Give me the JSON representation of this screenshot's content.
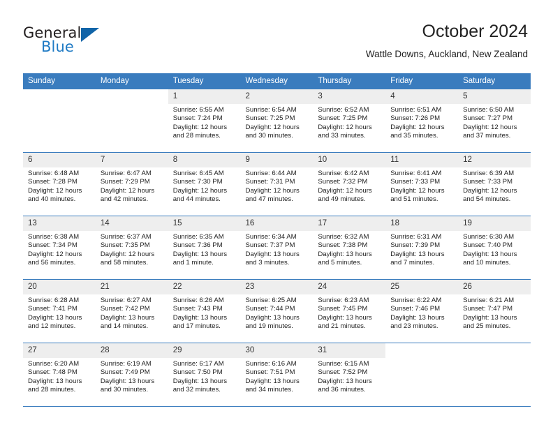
{
  "brand": {
    "name_part1": "General",
    "name_part2": "Blue",
    "accent_color": "#1064a8",
    "text_color": "#231f20"
  },
  "header": {
    "title": "October 2024",
    "subtitle": "Wattle Downs, Auckland, New Zealand"
  },
  "theme": {
    "header_row_bg": "#3a7cbe",
    "daynum_bg": "#eeeeee",
    "grid_line": "#3a7cbe"
  },
  "weekday_headers": [
    "Sunday",
    "Monday",
    "Tuesday",
    "Wednesday",
    "Thursday",
    "Friday",
    "Saturday"
  ],
  "weeks": [
    [
      {
        "day": "",
        "sunrise": "",
        "sunset": "",
        "daylight_line1": "",
        "daylight_line2": ""
      },
      {
        "day": "",
        "sunrise": "",
        "sunset": "",
        "daylight_line1": "",
        "daylight_line2": ""
      },
      {
        "day": "1",
        "sunrise": "Sunrise: 6:55 AM",
        "sunset": "Sunset: 7:24 PM",
        "daylight_line1": "Daylight: 12 hours",
        "daylight_line2": "and 28 minutes."
      },
      {
        "day": "2",
        "sunrise": "Sunrise: 6:54 AM",
        "sunset": "Sunset: 7:25 PM",
        "daylight_line1": "Daylight: 12 hours",
        "daylight_line2": "and 30 minutes."
      },
      {
        "day": "3",
        "sunrise": "Sunrise: 6:52 AM",
        "sunset": "Sunset: 7:25 PM",
        "daylight_line1": "Daylight: 12 hours",
        "daylight_line2": "and 33 minutes."
      },
      {
        "day": "4",
        "sunrise": "Sunrise: 6:51 AM",
        "sunset": "Sunset: 7:26 PM",
        "daylight_line1": "Daylight: 12 hours",
        "daylight_line2": "and 35 minutes."
      },
      {
        "day": "5",
        "sunrise": "Sunrise: 6:50 AM",
        "sunset": "Sunset: 7:27 PM",
        "daylight_line1": "Daylight: 12 hours",
        "daylight_line2": "and 37 minutes."
      }
    ],
    [
      {
        "day": "6",
        "sunrise": "Sunrise: 6:48 AM",
        "sunset": "Sunset: 7:28 PM",
        "daylight_line1": "Daylight: 12 hours",
        "daylight_line2": "and 40 minutes."
      },
      {
        "day": "7",
        "sunrise": "Sunrise: 6:47 AM",
        "sunset": "Sunset: 7:29 PM",
        "daylight_line1": "Daylight: 12 hours",
        "daylight_line2": "and 42 minutes."
      },
      {
        "day": "8",
        "sunrise": "Sunrise: 6:45 AM",
        "sunset": "Sunset: 7:30 PM",
        "daylight_line1": "Daylight: 12 hours",
        "daylight_line2": "and 44 minutes."
      },
      {
        "day": "9",
        "sunrise": "Sunrise: 6:44 AM",
        "sunset": "Sunset: 7:31 PM",
        "daylight_line1": "Daylight: 12 hours",
        "daylight_line2": "and 47 minutes."
      },
      {
        "day": "10",
        "sunrise": "Sunrise: 6:42 AM",
        "sunset": "Sunset: 7:32 PM",
        "daylight_line1": "Daylight: 12 hours",
        "daylight_line2": "and 49 minutes."
      },
      {
        "day": "11",
        "sunrise": "Sunrise: 6:41 AM",
        "sunset": "Sunset: 7:33 PM",
        "daylight_line1": "Daylight: 12 hours",
        "daylight_line2": "and 51 minutes."
      },
      {
        "day": "12",
        "sunrise": "Sunrise: 6:39 AM",
        "sunset": "Sunset: 7:33 PM",
        "daylight_line1": "Daylight: 12 hours",
        "daylight_line2": "and 54 minutes."
      }
    ],
    [
      {
        "day": "13",
        "sunrise": "Sunrise: 6:38 AM",
        "sunset": "Sunset: 7:34 PM",
        "daylight_line1": "Daylight: 12 hours",
        "daylight_line2": "and 56 minutes."
      },
      {
        "day": "14",
        "sunrise": "Sunrise: 6:37 AM",
        "sunset": "Sunset: 7:35 PM",
        "daylight_line1": "Daylight: 12 hours",
        "daylight_line2": "and 58 minutes."
      },
      {
        "day": "15",
        "sunrise": "Sunrise: 6:35 AM",
        "sunset": "Sunset: 7:36 PM",
        "daylight_line1": "Daylight: 13 hours",
        "daylight_line2": "and 1 minute."
      },
      {
        "day": "16",
        "sunrise": "Sunrise: 6:34 AM",
        "sunset": "Sunset: 7:37 PM",
        "daylight_line1": "Daylight: 13 hours",
        "daylight_line2": "and 3 minutes."
      },
      {
        "day": "17",
        "sunrise": "Sunrise: 6:32 AM",
        "sunset": "Sunset: 7:38 PM",
        "daylight_line1": "Daylight: 13 hours",
        "daylight_line2": "and 5 minutes."
      },
      {
        "day": "18",
        "sunrise": "Sunrise: 6:31 AM",
        "sunset": "Sunset: 7:39 PM",
        "daylight_line1": "Daylight: 13 hours",
        "daylight_line2": "and 7 minutes."
      },
      {
        "day": "19",
        "sunrise": "Sunrise: 6:30 AM",
        "sunset": "Sunset: 7:40 PM",
        "daylight_line1": "Daylight: 13 hours",
        "daylight_line2": "and 10 minutes."
      }
    ],
    [
      {
        "day": "20",
        "sunrise": "Sunrise: 6:28 AM",
        "sunset": "Sunset: 7:41 PM",
        "daylight_line1": "Daylight: 13 hours",
        "daylight_line2": "and 12 minutes."
      },
      {
        "day": "21",
        "sunrise": "Sunrise: 6:27 AM",
        "sunset": "Sunset: 7:42 PM",
        "daylight_line1": "Daylight: 13 hours",
        "daylight_line2": "and 14 minutes."
      },
      {
        "day": "22",
        "sunrise": "Sunrise: 6:26 AM",
        "sunset": "Sunset: 7:43 PM",
        "daylight_line1": "Daylight: 13 hours",
        "daylight_line2": "and 17 minutes."
      },
      {
        "day": "23",
        "sunrise": "Sunrise: 6:25 AM",
        "sunset": "Sunset: 7:44 PM",
        "daylight_line1": "Daylight: 13 hours",
        "daylight_line2": "and 19 minutes."
      },
      {
        "day": "24",
        "sunrise": "Sunrise: 6:23 AM",
        "sunset": "Sunset: 7:45 PM",
        "daylight_line1": "Daylight: 13 hours",
        "daylight_line2": "and 21 minutes."
      },
      {
        "day": "25",
        "sunrise": "Sunrise: 6:22 AM",
        "sunset": "Sunset: 7:46 PM",
        "daylight_line1": "Daylight: 13 hours",
        "daylight_line2": "and 23 minutes."
      },
      {
        "day": "26",
        "sunrise": "Sunrise: 6:21 AM",
        "sunset": "Sunset: 7:47 PM",
        "daylight_line1": "Daylight: 13 hours",
        "daylight_line2": "and 25 minutes."
      }
    ],
    [
      {
        "day": "27",
        "sunrise": "Sunrise: 6:20 AM",
        "sunset": "Sunset: 7:48 PM",
        "daylight_line1": "Daylight: 13 hours",
        "daylight_line2": "and 28 minutes."
      },
      {
        "day": "28",
        "sunrise": "Sunrise: 6:19 AM",
        "sunset": "Sunset: 7:49 PM",
        "daylight_line1": "Daylight: 13 hours",
        "daylight_line2": "and 30 minutes."
      },
      {
        "day": "29",
        "sunrise": "Sunrise: 6:17 AM",
        "sunset": "Sunset: 7:50 PM",
        "daylight_line1": "Daylight: 13 hours",
        "daylight_line2": "and 32 minutes."
      },
      {
        "day": "30",
        "sunrise": "Sunrise: 6:16 AM",
        "sunset": "Sunset: 7:51 PM",
        "daylight_line1": "Daylight: 13 hours",
        "daylight_line2": "and 34 minutes."
      },
      {
        "day": "31",
        "sunrise": "Sunrise: 6:15 AM",
        "sunset": "Sunset: 7:52 PM",
        "daylight_line1": "Daylight: 13 hours",
        "daylight_line2": "and 36 minutes."
      },
      {
        "day": "",
        "sunrise": "",
        "sunset": "",
        "daylight_line1": "",
        "daylight_line2": ""
      },
      {
        "day": "",
        "sunrise": "",
        "sunset": "",
        "daylight_line1": "",
        "daylight_line2": ""
      }
    ]
  ]
}
